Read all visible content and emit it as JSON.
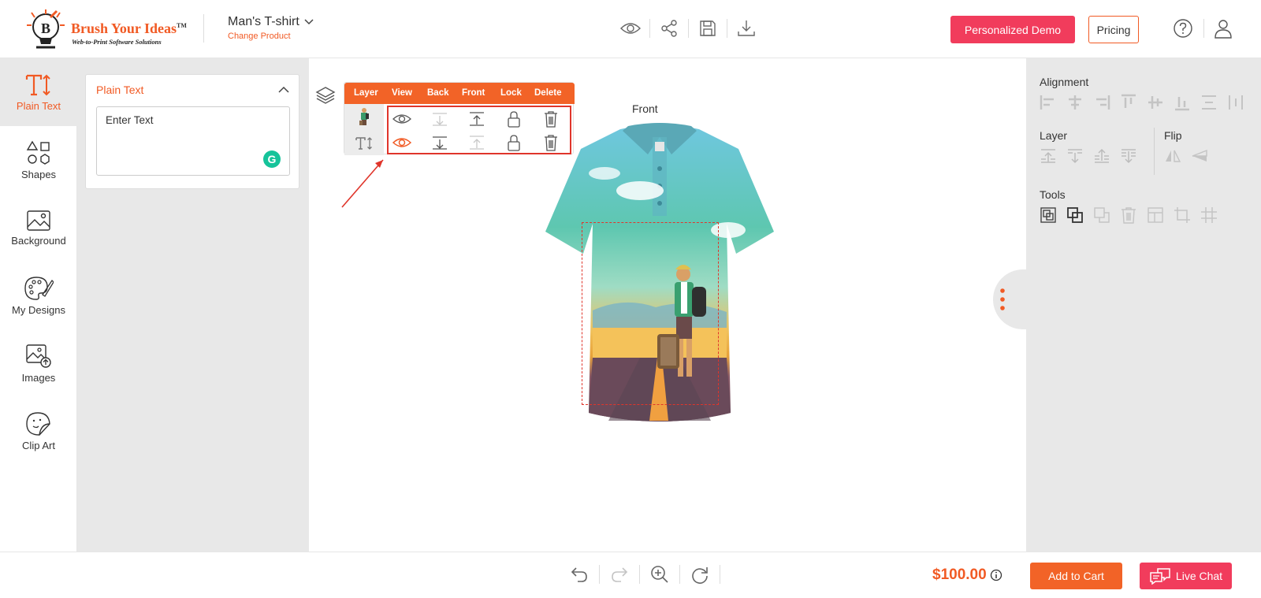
{
  "brand": {
    "name": "Brush Your Ideas",
    "trademark": "TM",
    "tagline": "Web-to-Print Software Solutions",
    "accent": "#f15a24"
  },
  "product": {
    "name": "Man's T-shirt",
    "change_label": "Change Product"
  },
  "header": {
    "tools": [
      "preview-icon",
      "share-icon",
      "save-icon",
      "download-icon"
    ],
    "demo_label": "Personalized Demo",
    "pricing_label": "Pricing"
  },
  "leftbar": {
    "items": [
      {
        "label": "Plain Text",
        "icon": "text-icon",
        "active": true
      },
      {
        "label": "Shapes",
        "icon": "shapes-icon"
      },
      {
        "label": "Background",
        "icon": "background-icon"
      },
      {
        "label": "My Designs",
        "icon": "palette-icon"
      },
      {
        "label": "Images",
        "icon": "image-upload-icon"
      },
      {
        "label": "Clip Art",
        "icon": "clipart-icon"
      }
    ]
  },
  "text_panel": {
    "title": "Plain Text",
    "input_value": "Enter Text"
  },
  "layer_popup": {
    "headers": [
      "Layer",
      "View",
      "Back",
      "Front",
      "Lock",
      "Delete"
    ],
    "rows": [
      {
        "thumb": "traveler-image",
        "view": "eye-icon",
        "back_enabled": false,
        "front_enabled": true
      },
      {
        "thumb": "text-layer",
        "view": "eye-icon-active",
        "back_enabled": true,
        "front_enabled": false
      }
    ]
  },
  "canvas": {
    "view_label": "Front"
  },
  "rightpanel": {
    "alignment_title": "Alignment",
    "layer_title": "Layer",
    "flip_title": "Flip",
    "tools_title": "Tools"
  },
  "footer": {
    "price": "$100.00",
    "cart_label": "Add to Cart",
    "chat_label": "Live Chat"
  },
  "colors": {
    "orange": "#f26327",
    "pink": "#f13c5c",
    "panel_gray": "#e8e8e8",
    "red_box": "#e0352b"
  }
}
